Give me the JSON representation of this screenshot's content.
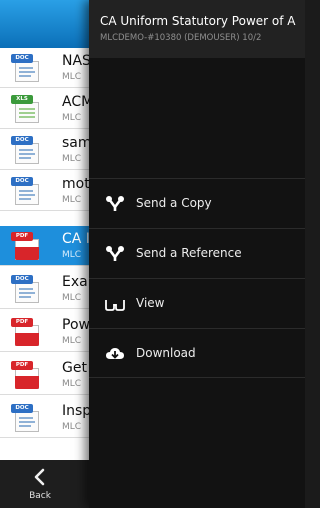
{
  "file_list": {
    "rows": [
      {
        "type_tag": "DOC",
        "icon": "doc-file-icon",
        "name": "NAS",
        "sub": "MLC"
      },
      {
        "type_tag": "XLS",
        "icon": "xls-file-icon",
        "name": "ACM",
        "sub": "MLC"
      },
      {
        "type_tag": "DOC",
        "icon": "doc-file-icon",
        "name": "sam",
        "sub": "MLC"
      },
      {
        "type_tag": "DOC",
        "icon": "doc-file-icon",
        "name": "mot",
        "sub": "MLC"
      },
      {
        "type_tag": "PDF",
        "icon": "pdf-file-icon",
        "name": "CA I",
        "sub": "MLC",
        "selected": true
      },
      {
        "type_tag": "DOC",
        "icon": "doc-file-icon",
        "name": "Exa",
        "sub": "MLC"
      },
      {
        "type_tag": "PDF",
        "icon": "pdf-file-icon",
        "name": "Pow",
        "sub": "MLC"
      },
      {
        "type_tag": "PDF",
        "icon": "pdf-file-icon",
        "name": "Get",
        "sub": "MLC"
      },
      {
        "type_tag": "DOC",
        "icon": "doc-file-icon",
        "name": "Insp",
        "sub": "MLC"
      }
    ]
  },
  "bottom_bar": {
    "back_label": "Back",
    "back_icon": "chevron-left-icon"
  },
  "panel": {
    "title": "CA Uniform Statutory Power of A",
    "subtitle": "MLCDEMO-#10380 (DEMOUSER) 10/2",
    "menu": [
      {
        "label": "Send a Copy",
        "icon": "share-icon"
      },
      {
        "label": "Send a Reference",
        "icon": "share-icon"
      },
      {
        "label": "View",
        "icon": "glasses-icon"
      },
      {
        "label": "Download",
        "icon": "cloud-download-icon"
      }
    ]
  },
  "colors": {
    "accent": "#1e8fdc",
    "panel_bg": "#121212",
    "header_bg": "#222222",
    "pdf": "#d8252a",
    "doc": "#2d6fc4",
    "xls": "#3b9a3b"
  }
}
